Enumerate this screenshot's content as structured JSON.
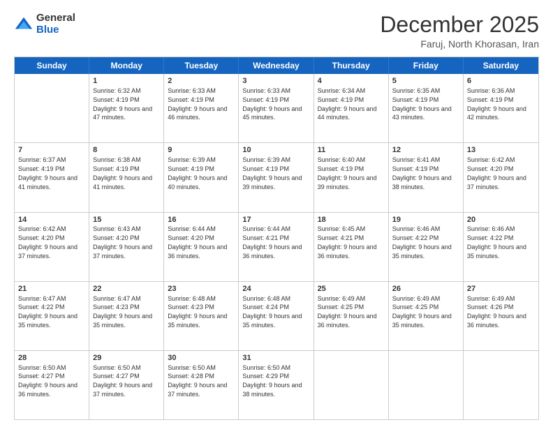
{
  "header": {
    "logo": {
      "general": "General",
      "blue": "Blue"
    },
    "title": "December 2025",
    "location": "Faruj, North Khorasan, Iran"
  },
  "days_of_week": [
    "Sunday",
    "Monday",
    "Tuesday",
    "Wednesday",
    "Thursday",
    "Friday",
    "Saturday"
  ],
  "weeks": [
    [
      {
        "day": "",
        "sunrise": "",
        "sunset": "",
        "daylight": ""
      },
      {
        "day": "1",
        "sunrise": "Sunrise: 6:32 AM",
        "sunset": "Sunset: 4:19 PM",
        "daylight": "Daylight: 9 hours and 47 minutes."
      },
      {
        "day": "2",
        "sunrise": "Sunrise: 6:33 AM",
        "sunset": "Sunset: 4:19 PM",
        "daylight": "Daylight: 9 hours and 46 minutes."
      },
      {
        "day": "3",
        "sunrise": "Sunrise: 6:33 AM",
        "sunset": "Sunset: 4:19 PM",
        "daylight": "Daylight: 9 hours and 45 minutes."
      },
      {
        "day": "4",
        "sunrise": "Sunrise: 6:34 AM",
        "sunset": "Sunset: 4:19 PM",
        "daylight": "Daylight: 9 hours and 44 minutes."
      },
      {
        "day": "5",
        "sunrise": "Sunrise: 6:35 AM",
        "sunset": "Sunset: 4:19 PM",
        "daylight": "Daylight: 9 hours and 43 minutes."
      },
      {
        "day": "6",
        "sunrise": "Sunrise: 6:36 AM",
        "sunset": "Sunset: 4:19 PM",
        "daylight": "Daylight: 9 hours and 42 minutes."
      }
    ],
    [
      {
        "day": "7",
        "sunrise": "Sunrise: 6:37 AM",
        "sunset": "Sunset: 4:19 PM",
        "daylight": "Daylight: 9 hours and 41 minutes."
      },
      {
        "day": "8",
        "sunrise": "Sunrise: 6:38 AM",
        "sunset": "Sunset: 4:19 PM",
        "daylight": "Daylight: 9 hours and 41 minutes."
      },
      {
        "day": "9",
        "sunrise": "Sunrise: 6:39 AM",
        "sunset": "Sunset: 4:19 PM",
        "daylight": "Daylight: 9 hours and 40 minutes."
      },
      {
        "day": "10",
        "sunrise": "Sunrise: 6:39 AM",
        "sunset": "Sunset: 4:19 PM",
        "daylight": "Daylight: 9 hours and 39 minutes."
      },
      {
        "day": "11",
        "sunrise": "Sunrise: 6:40 AM",
        "sunset": "Sunset: 4:19 PM",
        "daylight": "Daylight: 9 hours and 39 minutes."
      },
      {
        "day": "12",
        "sunrise": "Sunrise: 6:41 AM",
        "sunset": "Sunset: 4:19 PM",
        "daylight": "Daylight: 9 hours and 38 minutes."
      },
      {
        "day": "13",
        "sunrise": "Sunrise: 6:42 AM",
        "sunset": "Sunset: 4:20 PM",
        "daylight": "Daylight: 9 hours and 37 minutes."
      }
    ],
    [
      {
        "day": "14",
        "sunrise": "Sunrise: 6:42 AM",
        "sunset": "Sunset: 4:20 PM",
        "daylight": "Daylight: 9 hours and 37 minutes."
      },
      {
        "day": "15",
        "sunrise": "Sunrise: 6:43 AM",
        "sunset": "Sunset: 4:20 PM",
        "daylight": "Daylight: 9 hours and 37 minutes."
      },
      {
        "day": "16",
        "sunrise": "Sunrise: 6:44 AM",
        "sunset": "Sunset: 4:20 PM",
        "daylight": "Daylight: 9 hours and 36 minutes."
      },
      {
        "day": "17",
        "sunrise": "Sunrise: 6:44 AM",
        "sunset": "Sunset: 4:21 PM",
        "daylight": "Daylight: 9 hours and 36 minutes."
      },
      {
        "day": "18",
        "sunrise": "Sunrise: 6:45 AM",
        "sunset": "Sunset: 4:21 PM",
        "daylight": "Daylight: 9 hours and 36 minutes."
      },
      {
        "day": "19",
        "sunrise": "Sunrise: 6:46 AM",
        "sunset": "Sunset: 4:22 PM",
        "daylight": "Daylight: 9 hours and 35 minutes."
      },
      {
        "day": "20",
        "sunrise": "Sunrise: 6:46 AM",
        "sunset": "Sunset: 4:22 PM",
        "daylight": "Daylight: 9 hours and 35 minutes."
      }
    ],
    [
      {
        "day": "21",
        "sunrise": "Sunrise: 6:47 AM",
        "sunset": "Sunset: 4:22 PM",
        "daylight": "Daylight: 9 hours and 35 minutes."
      },
      {
        "day": "22",
        "sunrise": "Sunrise: 6:47 AM",
        "sunset": "Sunset: 4:23 PM",
        "daylight": "Daylight: 9 hours and 35 minutes."
      },
      {
        "day": "23",
        "sunrise": "Sunrise: 6:48 AM",
        "sunset": "Sunset: 4:23 PM",
        "daylight": "Daylight: 9 hours and 35 minutes."
      },
      {
        "day": "24",
        "sunrise": "Sunrise: 6:48 AM",
        "sunset": "Sunset: 4:24 PM",
        "daylight": "Daylight: 9 hours and 35 minutes."
      },
      {
        "day": "25",
        "sunrise": "Sunrise: 6:49 AM",
        "sunset": "Sunset: 4:25 PM",
        "daylight": "Daylight: 9 hours and 36 minutes."
      },
      {
        "day": "26",
        "sunrise": "Sunrise: 6:49 AM",
        "sunset": "Sunset: 4:25 PM",
        "daylight": "Daylight: 9 hours and 35 minutes."
      },
      {
        "day": "27",
        "sunrise": "Sunrise: 6:49 AM",
        "sunset": "Sunset: 4:26 PM",
        "daylight": "Daylight: 9 hours and 36 minutes."
      }
    ],
    [
      {
        "day": "28",
        "sunrise": "Sunrise: 6:50 AM",
        "sunset": "Sunset: 4:27 PM",
        "daylight": "Daylight: 9 hours and 36 minutes."
      },
      {
        "day": "29",
        "sunrise": "Sunrise: 6:50 AM",
        "sunset": "Sunset: 4:27 PM",
        "daylight": "Daylight: 9 hours and 37 minutes."
      },
      {
        "day": "30",
        "sunrise": "Sunrise: 6:50 AM",
        "sunset": "Sunset: 4:28 PM",
        "daylight": "Daylight: 9 hours and 37 minutes."
      },
      {
        "day": "31",
        "sunrise": "Sunrise: 6:50 AM",
        "sunset": "Sunset: 4:29 PM",
        "daylight": "Daylight: 9 hours and 38 minutes."
      },
      {
        "day": "",
        "sunrise": "",
        "sunset": "",
        "daylight": ""
      },
      {
        "day": "",
        "sunrise": "",
        "sunset": "",
        "daylight": ""
      },
      {
        "day": "",
        "sunrise": "",
        "sunset": "",
        "daylight": ""
      }
    ]
  ]
}
